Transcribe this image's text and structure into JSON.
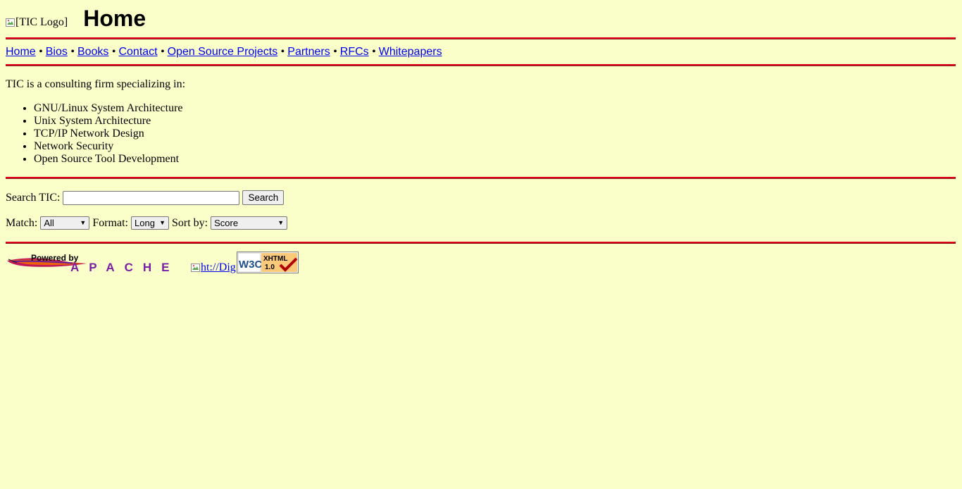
{
  "header": {
    "logo_alt": "[TIC Logo]",
    "title": "Home"
  },
  "nav": {
    "items": [
      {
        "label": "Home"
      },
      {
        "label": "Bios"
      },
      {
        "label": "Books"
      },
      {
        "label": "Contact"
      },
      {
        "label": "Open Source Projects"
      },
      {
        "label": "Partners"
      },
      {
        "label": "RFCs"
      },
      {
        "label": "Whitepapers"
      }
    ],
    "separator": "•"
  },
  "content": {
    "intro": "TIC is a consulting firm specializing in:",
    "specialties": [
      "GNU/Linux System Architecture",
      "Unix System Architecture",
      "TCP/IP Network Design",
      "Network Security",
      "Open Source Tool Development"
    ]
  },
  "search": {
    "label": "Search TIC:",
    "value": "",
    "button_label": "Search",
    "match_label": "Match:",
    "match_value": "All",
    "format_label": "Format:",
    "format_value": "Long",
    "sort_label": "Sort by:",
    "sort_value": "Score"
  },
  "footer": {
    "apache_badge": {
      "top_text": "Powered by",
      "bottom_text": "APACHE"
    },
    "htdig_alt": "ht://Dig",
    "w3c_badge": {
      "left_text": "W3C",
      "right_text_top": "XHTML",
      "right_text_bottom": "1.0"
    }
  },
  "colors": {
    "background": "#fafec8",
    "rule": "#e0001a",
    "link": "#0000ee"
  }
}
